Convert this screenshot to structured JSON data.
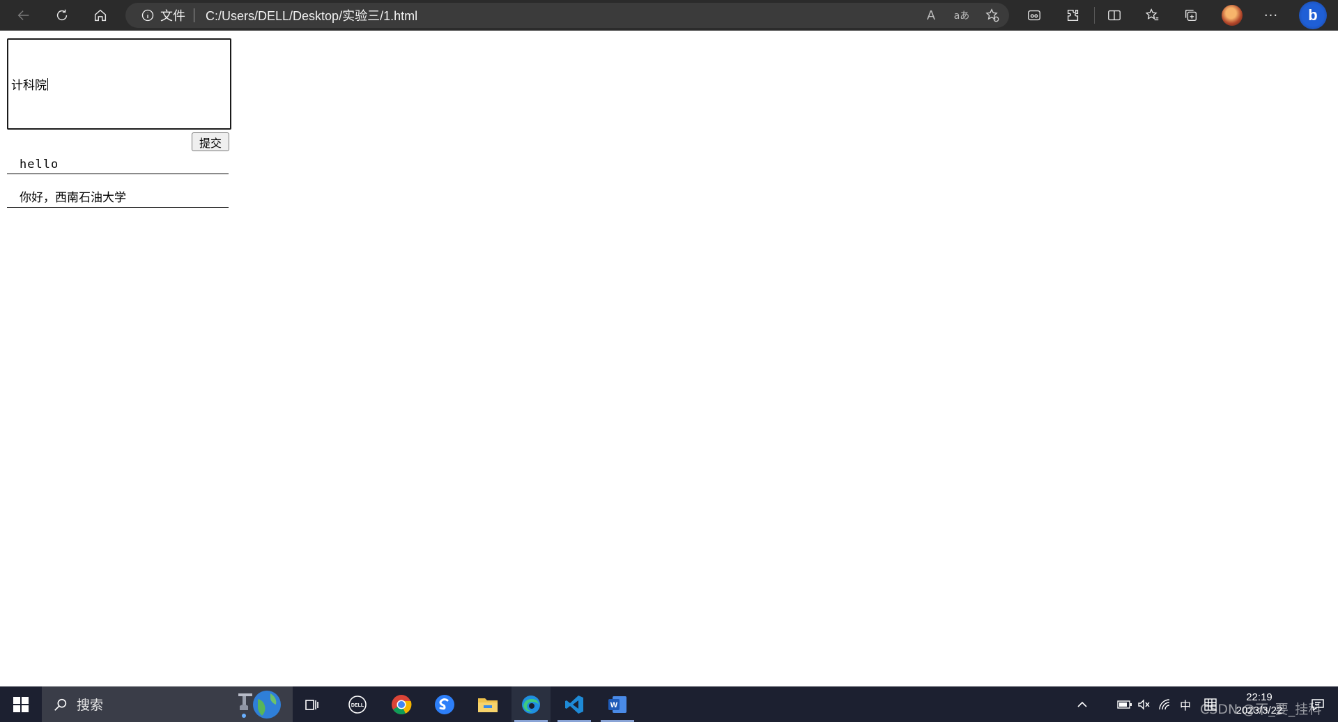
{
  "browser": {
    "address": {
      "scheme_label": "文件",
      "url": "C:/Users/DELL/Desktop/实验三/1.html"
    },
    "read_aloud_label": "A",
    "translate_label": "aあ",
    "more_label": "···",
    "copilot_label": "b"
  },
  "page": {
    "textarea_value": "计科院",
    "submit_label": "提交",
    "messages": [
      {
        "text": "hello"
      },
      {
        "text": "你好，西南石油大学"
      }
    ]
  },
  "taskbar": {
    "search_placeholder": "搜索",
    "ime_label": "中",
    "time": "22:19",
    "date": "2023/3/22",
    "watermark": "CSDN @不_要_挂科"
  },
  "colors": {
    "toolbar_bg": "#2b2b2b",
    "address_bg": "#3b3b3b",
    "taskbar_bg": "#1c2030",
    "page_bg": "#ffffff"
  }
}
